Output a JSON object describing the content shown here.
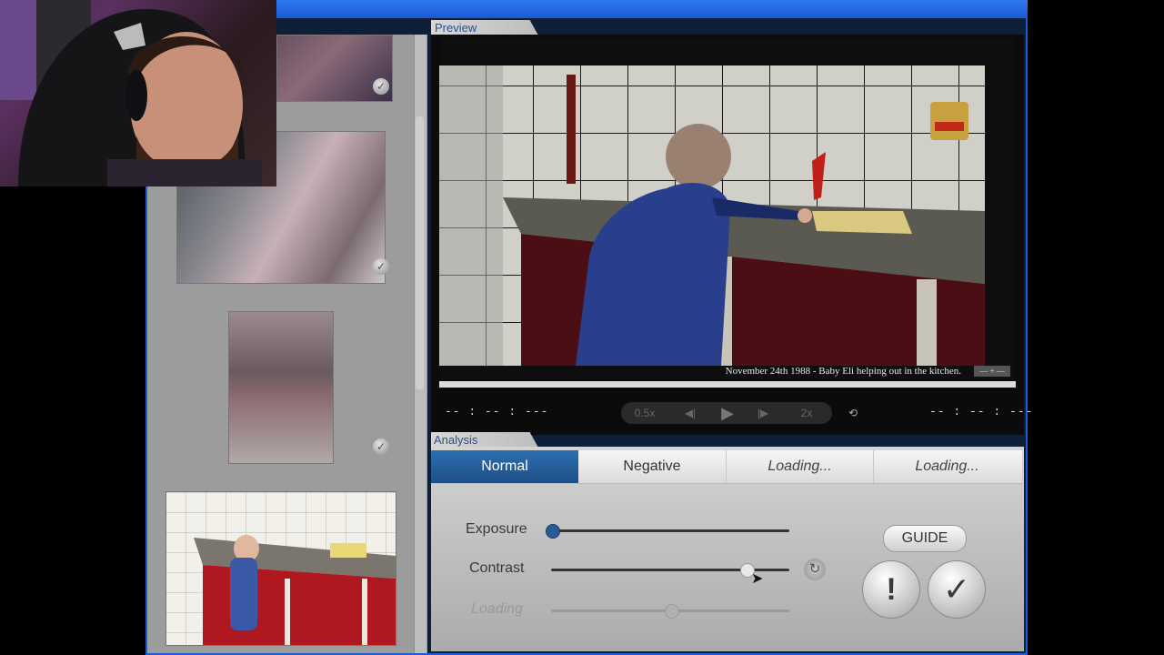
{
  "preview": {
    "label": "Preview",
    "caption": "November 24th 1988 - Baby Eli helping out in the kitchen.",
    "caption_control": "— + —",
    "time_left": "-- : -- : ---",
    "time_right": "-- : -- : ---",
    "speed_slow": "0.5x",
    "speed_fast": "2x"
  },
  "analysis": {
    "label": "Analysis",
    "tabs": [
      {
        "label": "Normal"
      },
      {
        "label": "Negative"
      },
      {
        "label": "Loading..."
      },
      {
        "label": "Loading..."
      }
    ],
    "sliders": [
      {
        "label": "Exposure",
        "value": 0.0
      },
      {
        "label": "Contrast",
        "value": 0.82
      },
      {
        "label": "Loading",
        "value": 0.5
      }
    ],
    "guide_label": "GUIDE",
    "alert_glyph": "!",
    "confirm_glyph": "✓"
  },
  "colors": {
    "accent": "#2d6fb0",
    "window_blue": "#1c5fd0"
  }
}
